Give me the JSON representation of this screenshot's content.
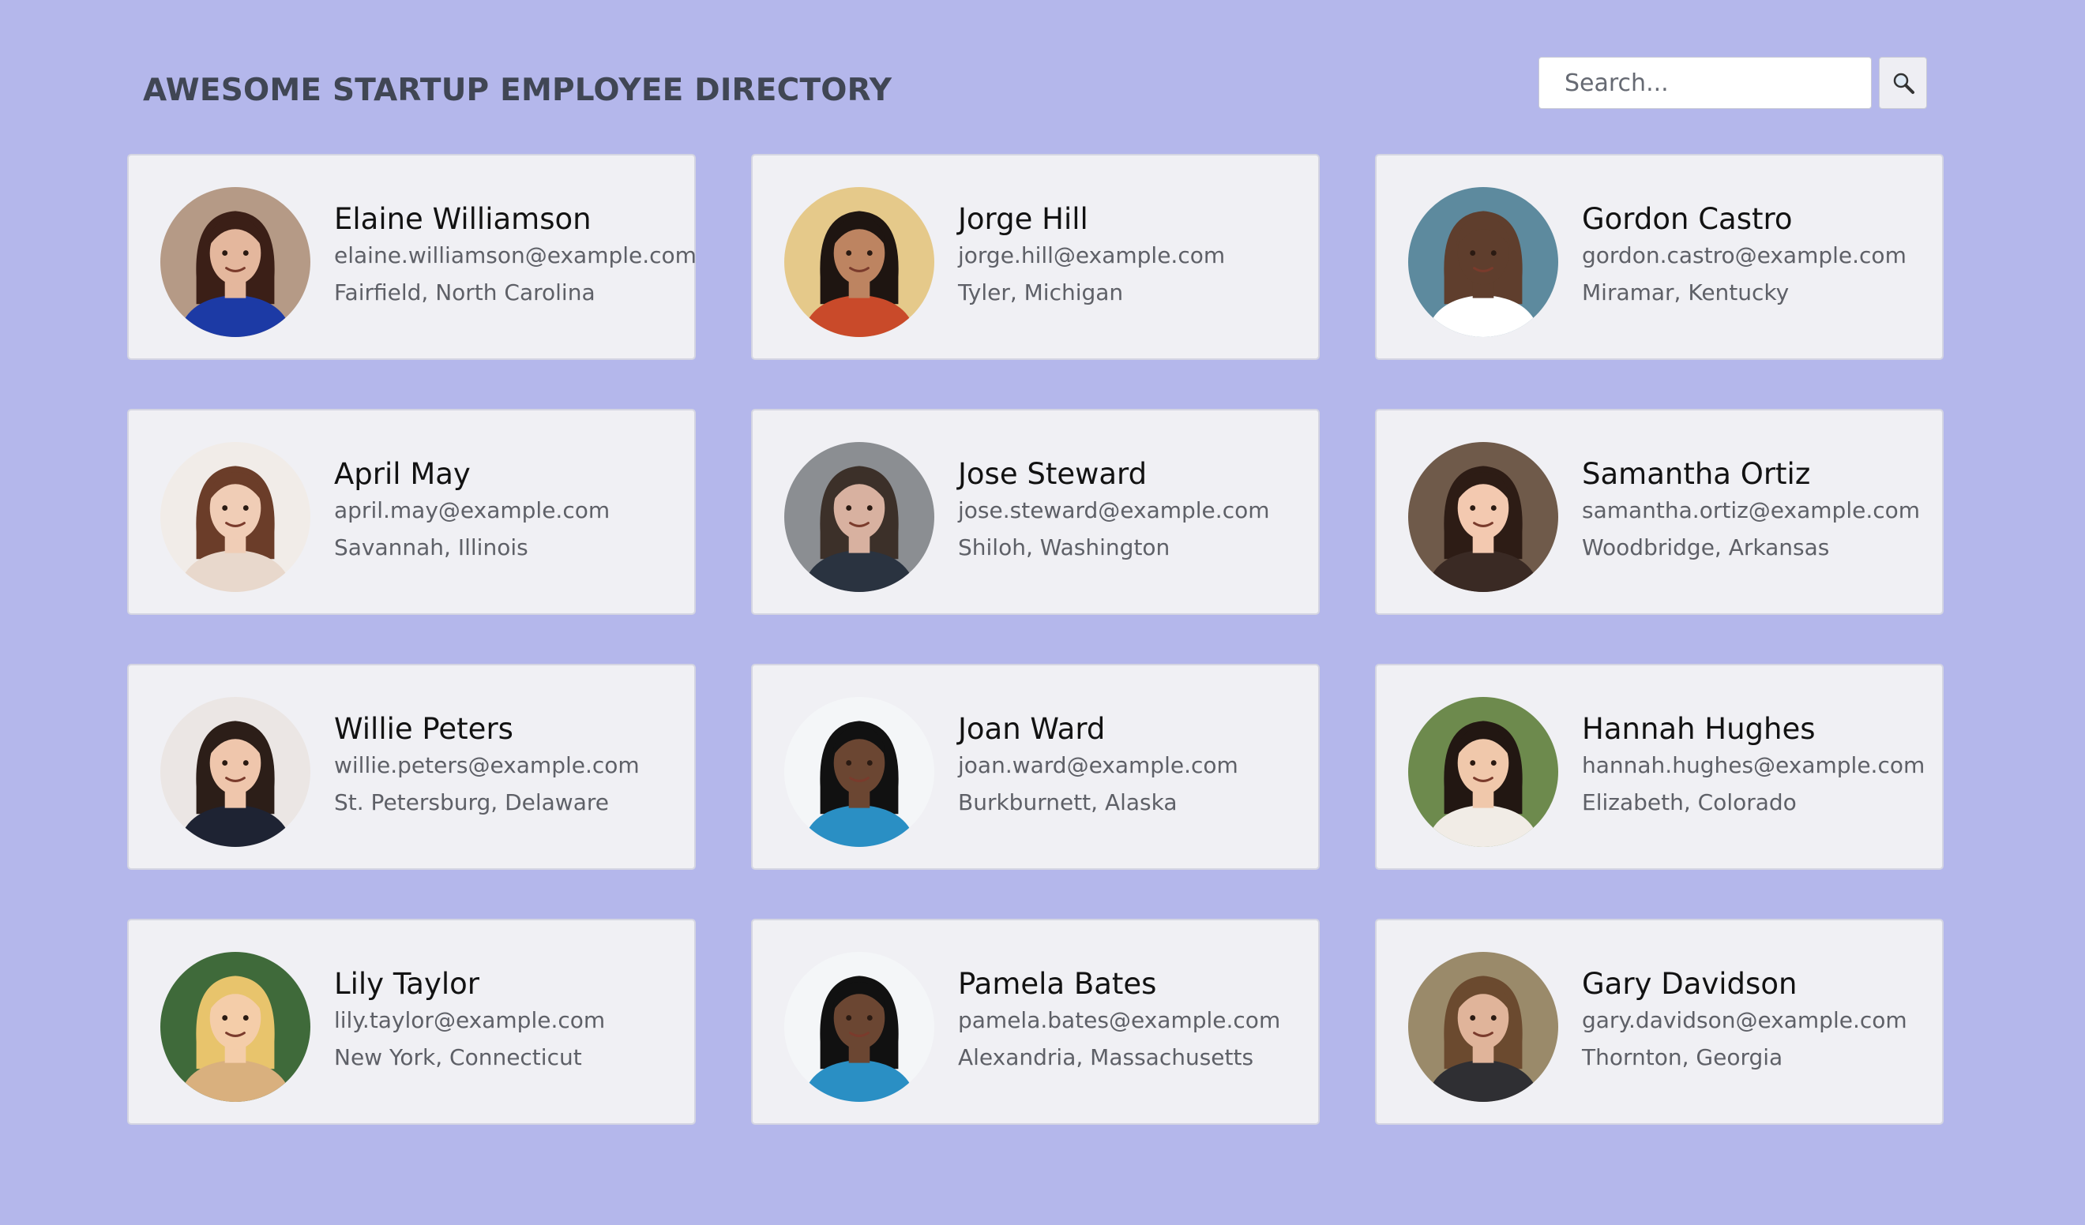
{
  "header": {
    "title": "AWESOME STARTUP EMPLOYEE DIRECTORY",
    "search": {
      "placeholder": "Search...",
      "value": "",
      "button_icon": "search-icon"
    }
  },
  "colors": {
    "background": "#b4b7eb",
    "card": "#f0f0f4",
    "name": "#121212",
    "detail": "#5e6067"
  },
  "employees": [
    {
      "name": "Elaine Williamson",
      "email": "elaine.williamson@example.com",
      "location": "Fairfield, North Carolina",
      "avatar": {
        "bg": "#b59a86",
        "skin": "#e4b79d",
        "hair": "#3b1f17",
        "shirt": "#1c3aa5"
      }
    },
    {
      "name": "Jorge Hill",
      "email": "jorge.hill@example.com",
      "location": "Tyler, Michigan",
      "avatar": {
        "bg": "#e5c98a",
        "skin": "#bd8461",
        "hair": "#1e1511",
        "shirt": "#c94a2a"
      }
    },
    {
      "name": "Gordon Castro",
      "email": "gordon.castro@example.com",
      "location": "Miramar, Kentucky",
      "avatar": {
        "bg": "#5d8a9e",
        "skin": "#5f3e2d",
        "hair": "#5f3e2d",
        "shirt": "#ffffff"
      }
    },
    {
      "name": "April May",
      "email": "april.may@example.com",
      "location": "Savannah, Illinois",
      "avatar": {
        "bg": "#f1ece8",
        "skin": "#f0cdb6",
        "hair": "#6b3d29",
        "shirt": "#e8d8cc"
      }
    },
    {
      "name": "Jose Steward",
      "email": "jose.steward@example.com",
      "location": "Shiloh, Washington",
      "avatar": {
        "bg": "#8b8e92",
        "skin": "#d8b1a0",
        "hair": "#3c3029",
        "shirt": "#2a3340"
      }
    },
    {
      "name": "Samantha Ortiz",
      "email": "samantha.ortiz@example.com",
      "location": "Woodbridge, Arkansas",
      "avatar": {
        "bg": "#6f5a4a",
        "skin": "#f3c9b0",
        "hair": "#2d1c15",
        "shirt": "#3a2a24"
      }
    },
    {
      "name": "Willie Peters",
      "email": "willie.peters@example.com",
      "location": "St. Petersburg, Delaware",
      "avatar": {
        "bg": "#ebe6e4",
        "skin": "#efc6ac",
        "hair": "#2c1e18",
        "shirt": "#1e2333"
      }
    },
    {
      "name": "Joan Ward",
      "email": "joan.ward@example.com",
      "location": "Burkburnett, Alaska",
      "avatar": {
        "bg": "#f4f6f8",
        "skin": "#6b4632",
        "hair": "#111111",
        "shirt": "#2a8fc4"
      }
    },
    {
      "name": "Hannah Hughes",
      "email": "hannah.hughes@example.com",
      "location": "Elizabeth, Colorado",
      "avatar": {
        "bg": "#6d8a4d",
        "skin": "#f0c8ab",
        "hair": "#221712",
        "shirt": "#f1ece6"
      }
    },
    {
      "name": "Lily Taylor",
      "email": "lily.taylor@example.com",
      "location": "New York, Connecticut",
      "avatar": {
        "bg": "#3f6a3a",
        "skin": "#f4cda9",
        "hair": "#e8c46c",
        "shirt": "#d9b07e"
      }
    },
    {
      "name": "Pamela Bates",
      "email": "pamela.bates@example.com",
      "location": "Alexandria, Massachusetts",
      "avatar": {
        "bg": "#f4f6f8",
        "skin": "#6b4632",
        "hair": "#111111",
        "shirt": "#2a8fc4"
      }
    },
    {
      "name": "Gary Davidson",
      "email": "gary.davidson@example.com",
      "location": "Thornton, Georgia",
      "avatar": {
        "bg": "#9a8a6a",
        "skin": "#e0b49a",
        "hair": "#6b4a2f",
        "shirt": "#2f2f33"
      }
    }
  ]
}
